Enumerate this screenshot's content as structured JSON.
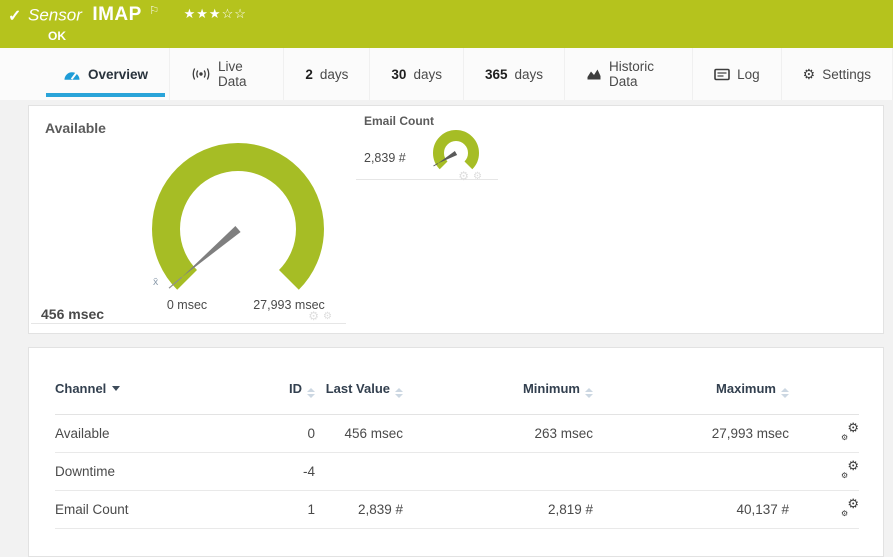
{
  "header": {
    "check": "✓",
    "kind": "Sensor",
    "name": "IMAP",
    "flag": "⚐",
    "status": "OK",
    "stars_filled": "★★★",
    "stars_empty": "☆☆",
    "priority": {
      "filled": 3,
      "total": 5
    },
    "color": "#b5c31d"
  },
  "tabs": [
    {
      "label": "Overview",
      "active": true
    },
    {
      "label": "Live Data"
    },
    {
      "num": "2",
      "label": "days"
    },
    {
      "num": "30",
      "label": "days"
    },
    {
      "num": "365",
      "label": "days"
    },
    {
      "label": "Historic Data"
    },
    {
      "label": "Log"
    },
    {
      "label": "Settings"
    }
  ],
  "gauges": {
    "available": {
      "title": "Available",
      "current": "456 msec",
      "scale_start": "0 msec",
      "scale_end": "27,993 msec",
      "value": 456,
      "min": 0,
      "max": 27993,
      "unit": "msec",
      "mean_marker": "x̄",
      "color": "#a6bd25"
    },
    "email_count": {
      "title": "Email Count",
      "current": "2,839 #",
      "value": 2839,
      "unit": "#",
      "color": "#a6bd25"
    }
  },
  "table": {
    "sorted_by": "Channel",
    "columns": {
      "channel": "Channel",
      "id": "ID",
      "last_value": "Last Value",
      "minimum": "Minimum",
      "maximum": "Maximum"
    },
    "rows": [
      {
        "channel": "Available",
        "id": "0",
        "last": "456 msec",
        "min": "263 msec",
        "max": "27,993 msec"
      },
      {
        "channel": "Downtime",
        "id": "-4",
        "last": "",
        "min": "",
        "max": ""
      },
      {
        "channel": "Email Count",
        "id": "1",
        "last": "2,839 #",
        "min": "2,819 #",
        "max": "40,137 #"
      }
    ]
  },
  "icons": {
    "gear": "⚙"
  },
  "colors": {
    "status_ok_green": "#b5c31d",
    "gauge_green": "#a6bd25",
    "accent_blue": "#2aa4d9"
  }
}
